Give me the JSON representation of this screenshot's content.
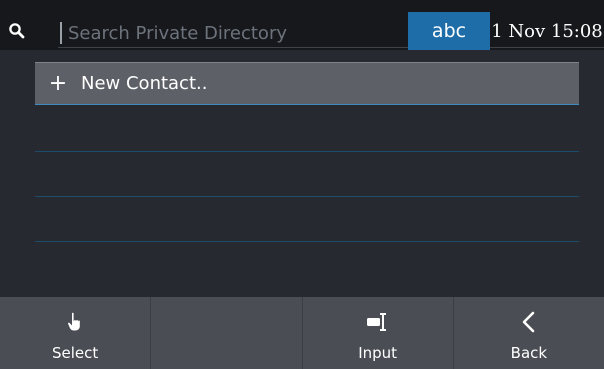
{
  "header": {
    "search_placeholder": "Search Private Directory",
    "input_mode": "abc",
    "datetime": "1 Nov 15:08"
  },
  "list": {
    "items": [
      {
        "icon": "plus-icon",
        "label": "New Contact.."
      }
    ]
  },
  "softkeys": [
    {
      "label": "Select",
      "icon": "hand-pointer-icon"
    },
    {
      "label": "",
      "icon": ""
    },
    {
      "label": "Input",
      "icon": "text-cursor-icon"
    },
    {
      "label": "Back",
      "icon": "chevron-left-icon"
    }
  ],
  "colors": {
    "background": "#262930",
    "accent": "#1f6da8",
    "selected_row": "#5d6066",
    "softkey_bar": "#4a4d53"
  }
}
